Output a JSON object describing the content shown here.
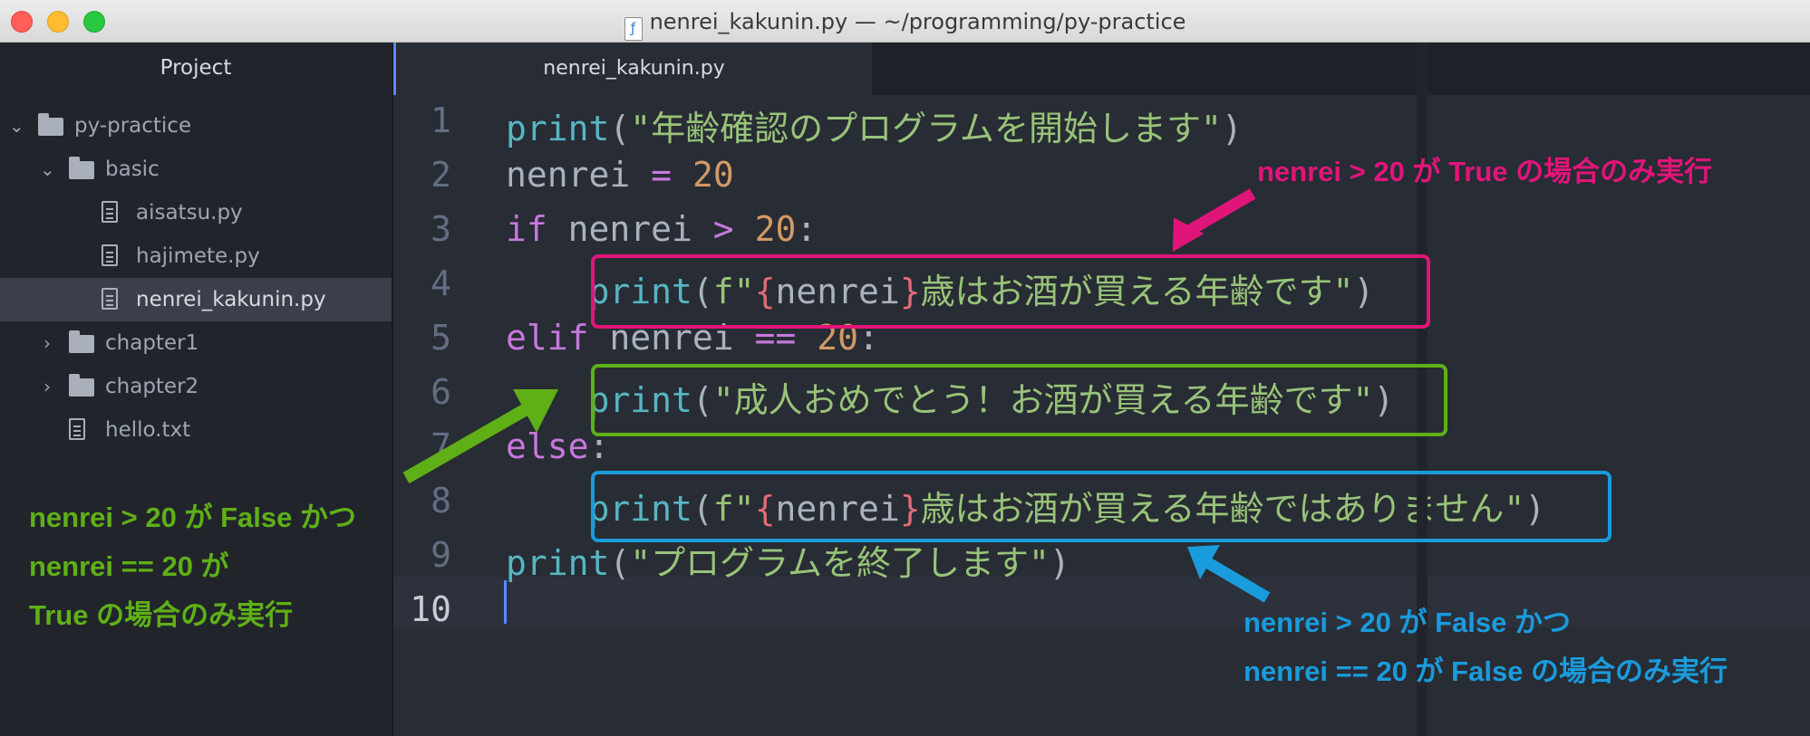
{
  "window": {
    "title": "nenrei_kakunin.py — ~/programming/py-practice",
    "traffic_lights": [
      "#ff5f57",
      "#febc2e",
      "#28c840"
    ]
  },
  "sidebar": {
    "header": "Project",
    "tree": [
      {
        "label": "py-practice",
        "kind": "folder",
        "expanded": true
      },
      {
        "label": "basic",
        "kind": "folder",
        "expanded": true
      },
      {
        "label": "aisatsu.py",
        "kind": "file"
      },
      {
        "label": "hajimete.py",
        "kind": "file"
      },
      {
        "label": "nenrei_kakunin.py",
        "kind": "file",
        "selected": true
      },
      {
        "label": "chapter1",
        "kind": "folder",
        "expanded": false
      },
      {
        "label": "chapter2",
        "kind": "folder",
        "expanded": false
      },
      {
        "label": "hello.txt",
        "kind": "file"
      }
    ]
  },
  "editor": {
    "tab_label": "nenrei_kakunin.py",
    "line_numbers": [
      "1",
      "2",
      "3",
      "4",
      "5",
      "6",
      "7",
      "8",
      "9",
      "10"
    ],
    "lines": [
      [
        [
          "fn",
          "print"
        ],
        [
          "pl",
          "("
        ],
        [
          "st",
          "\"年齢確認のプログラムを開始します\""
        ],
        [
          "pl",
          ")"
        ]
      ],
      [
        [
          "pl",
          "nenrei "
        ],
        [
          "op",
          "="
        ],
        [
          "pl",
          " "
        ],
        [
          "nm",
          "20"
        ]
      ],
      [
        [
          "kw",
          "if"
        ],
        [
          "pl",
          " nenrei "
        ],
        [
          "op",
          ">"
        ],
        [
          "pl",
          " "
        ],
        [
          "nm",
          "20"
        ],
        [
          "pl",
          ":"
        ]
      ],
      [
        [
          "pl",
          "    "
        ],
        [
          "fn",
          "print"
        ],
        [
          "pl",
          "("
        ],
        [
          "st",
          "f\""
        ],
        [
          "br",
          "{"
        ],
        [
          "pl",
          "nenrei"
        ],
        [
          "br",
          "}"
        ],
        [
          "st",
          "歳はお酒が買える年齢です\""
        ],
        [
          "pl",
          ")"
        ]
      ],
      [
        [
          "kw",
          "elif"
        ],
        [
          "pl",
          " nenrei "
        ],
        [
          "op",
          "=="
        ],
        [
          "pl",
          " "
        ],
        [
          "nm",
          "20"
        ],
        [
          "pl",
          ":"
        ]
      ],
      [
        [
          "pl",
          "    "
        ],
        [
          "fn",
          "print"
        ],
        [
          "pl",
          "("
        ],
        [
          "st",
          "\"成人おめでとう！お酒が買える年齢です\""
        ],
        [
          "pl",
          ")"
        ]
      ],
      [
        [
          "kw",
          "else"
        ],
        [
          "pl",
          ":"
        ]
      ],
      [
        [
          "pl",
          "    "
        ],
        [
          "fn",
          "print"
        ],
        [
          "pl",
          "("
        ],
        [
          "st",
          "f\""
        ],
        [
          "br",
          "{"
        ],
        [
          "pl",
          "nenrei"
        ],
        [
          "br",
          "}"
        ],
        [
          "st",
          "歳はお酒が買える年齢ではありません\""
        ],
        [
          "pl",
          ")"
        ]
      ],
      [
        [
          "fn",
          "print"
        ],
        [
          "pl",
          "("
        ],
        [
          "st",
          "\"プログラムを終了します\""
        ],
        [
          "pl",
          ")"
        ]
      ],
      []
    ]
  },
  "annotations": {
    "pink": {
      "color": "#e0157a",
      "lines": [
        "nenrei > 20 が True の場合のみ実行"
      ]
    },
    "green": {
      "color": "#5fb016",
      "lines": [
        "nenrei > 20 が False かつ",
        "nenrei == 20 が",
        "True の場合のみ実行"
      ]
    },
    "blue": {
      "color": "#1a9bdc",
      "lines": [
        "nenrei > 20 が False かつ",
        "nenrei == 20 が False の場合のみ実行"
      ]
    }
  }
}
